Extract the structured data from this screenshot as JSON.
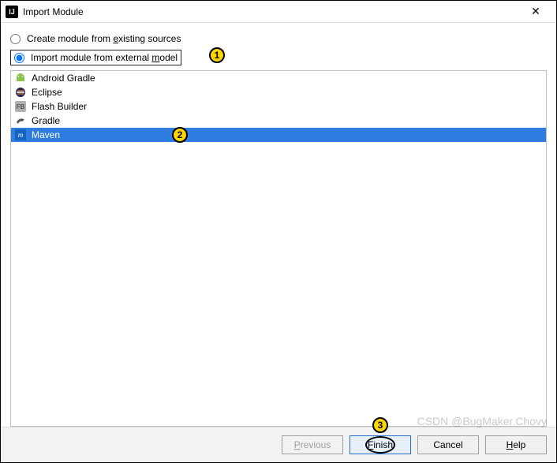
{
  "window": {
    "title": "Import Module",
    "app_icon_text": "IJ",
    "close_glyph": "✕"
  },
  "options": {
    "create_label_pre": "Create module from ",
    "create_label_u": "e",
    "create_label_post": "xisting sources",
    "import_label_pre": "Import module from external ",
    "import_label_u": "m",
    "import_label_post": "odel",
    "selected": "import"
  },
  "models": [
    {
      "name": "Android Gradle",
      "icon": "android",
      "selected": false
    },
    {
      "name": "Eclipse",
      "icon": "eclipse",
      "selected": false
    },
    {
      "name": "Flash Builder",
      "icon": "flashbuilder",
      "selected": false
    },
    {
      "name": "Gradle",
      "icon": "gradle",
      "selected": false
    },
    {
      "name": "Maven",
      "icon": "maven",
      "selected": true
    }
  ],
  "buttons": {
    "previous": "Previous",
    "finish": "Finish",
    "cancel": "Cancel",
    "help": "Help"
  },
  "annotations": {
    "badge1": "1",
    "badge2": "2",
    "badge3": "3"
  },
  "watermark": "CSDN @BugMaker.Chovy"
}
